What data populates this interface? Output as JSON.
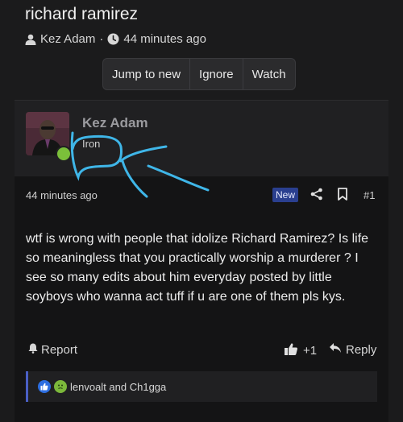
{
  "thread": {
    "title": "richard ramirez",
    "author": "Kez Adam",
    "separator": "·",
    "time": "44 minutes ago"
  },
  "actions": {
    "jump_to_new": "Jump to new",
    "ignore": "Ignore",
    "watch": "Watch"
  },
  "post": {
    "username": "Kez Adam",
    "user_title": "Iron",
    "time": "44 minutes ago",
    "new_badge": "New",
    "number": "#1",
    "body": "wtf is wrong with people that idolize Richard Ramirez? Is life so meaningless that you practically worship a murderer ? I see so many edits about him everyday posted by little soyboys who wanna act tuff if u are one of them pls kys.",
    "report_label": "Report",
    "like_count": "+1",
    "reply_label": "Reply",
    "reactions_text": "lenvoalt and Ch1gga"
  },
  "colors": {
    "background": "#1b1b1c",
    "accent_badge": "#2a3f8f",
    "online": "#7bbf3a",
    "annotation": "#3fb6e8"
  },
  "icons": [
    "user-icon",
    "clock-icon",
    "share-icon",
    "bookmark-icon",
    "report-icon",
    "thumbs-up-icon",
    "reply-icon",
    "like-reaction-icon",
    "sick-reaction-icon"
  ]
}
